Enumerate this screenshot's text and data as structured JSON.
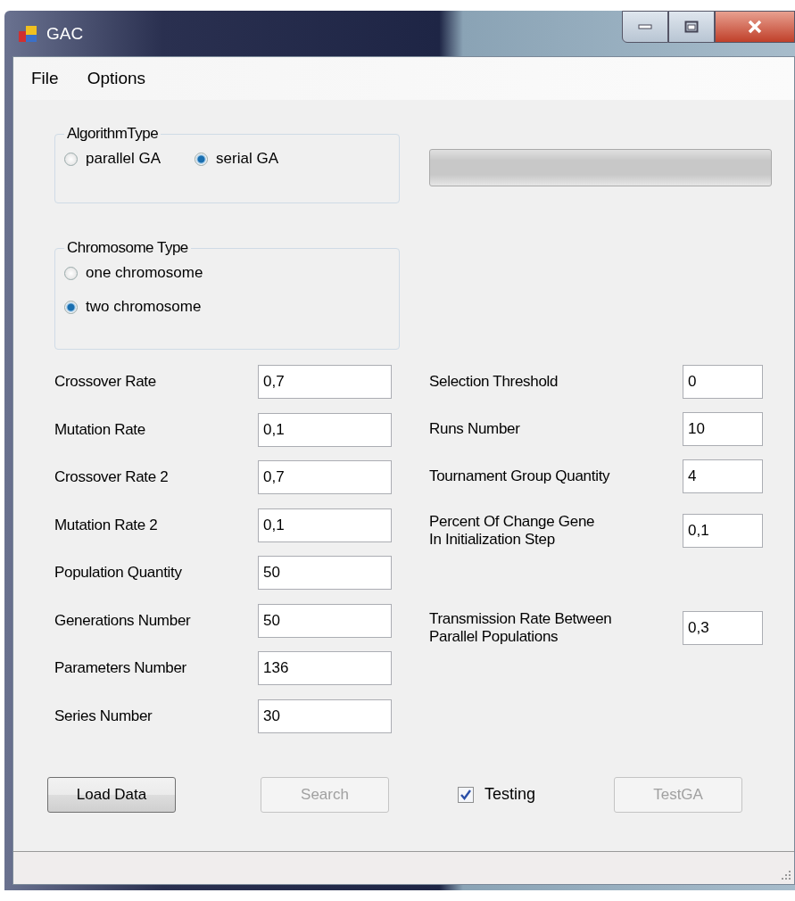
{
  "window": {
    "title": "GAC"
  },
  "menu": [
    "File",
    "Options"
  ],
  "algorithm_type": {
    "title": "AlgorithmType",
    "options": [
      {
        "label": "parallel GA",
        "selected": false
      },
      {
        "label": "serial GA",
        "selected": true
      }
    ]
  },
  "progress": {
    "level": 0
  },
  "chromosome_type": {
    "title": "Chromosome Type",
    "options": [
      {
        "label": "one chromosome",
        "selected": false
      },
      {
        "label": "two chromosome",
        "selected": true
      }
    ]
  },
  "left_fields": [
    {
      "label": "Crossover Rate",
      "value": "0,7"
    },
    {
      "label": "Mutation Rate",
      "value": "0,1"
    },
    {
      "label": "Crossover Rate 2",
      "value": "0,7"
    },
    {
      "label": "Mutation Rate 2",
      "value": "0,1"
    },
    {
      "label": "Population Quantity",
      "value": "50"
    },
    {
      "label": "Generations Number",
      "value": "50"
    },
    {
      "label": "Parameters Number",
      "value": "136"
    },
    {
      "label": "Series Number",
      "value": "30"
    }
  ],
  "right_fields": [
    {
      "label": [
        "Selection Threshold"
      ],
      "value": "0"
    },
    {
      "label": [
        "Runs Number"
      ],
      "value": "10"
    },
    {
      "label": [
        "Tournament Group Quantity"
      ],
      "value": "4"
    },
    {
      "label": [
        "Percent Of Change Gene",
        "In Initialization Step"
      ],
      "value": "0,1"
    },
    {
      "label": [
        "Transmission Rate Between",
        "Parallel Populations"
      ],
      "value": "0,3"
    }
  ],
  "load_button": {
    "label": "Load Data",
    "disabled": false
  },
  "search_button": {
    "label": "Search",
    "disabled": true
  },
  "testing": {
    "label": "Testing",
    "checked": true
  },
  "test_button": {
    "label": "TestGA",
    "disabled": true
  }
}
